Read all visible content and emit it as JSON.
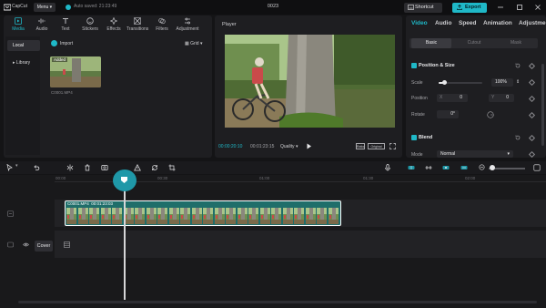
{
  "app": {
    "name": "CapCut",
    "menu_label": "Menu",
    "autosave_text": "Auto saved: 21:23:49",
    "project_title": "0023",
    "shortcut_label": "Shortcut",
    "export_label": "Export"
  },
  "media_panel": {
    "tabs": [
      {
        "label": "Media",
        "icon": "media-icon",
        "active": true
      },
      {
        "label": "Audio",
        "icon": "audio-icon",
        "active": false
      },
      {
        "label": "Text",
        "icon": "text-icon",
        "active": false
      },
      {
        "label": "Stickers",
        "icon": "stickers-icon",
        "active": false
      },
      {
        "label": "Effects",
        "icon": "effects-icon",
        "active": false
      },
      {
        "label": "Transitions",
        "icon": "transitions-icon",
        "active": false
      },
      {
        "label": "Filters",
        "icon": "filters-icon",
        "active": false
      },
      {
        "label": "Adjustment",
        "icon": "adjustment-icon",
        "active": false
      }
    ],
    "nav": [
      {
        "label": "Local",
        "active": true
      },
      {
        "label": "▸ Library",
        "active": false
      }
    ],
    "import_label": "Import",
    "view_label": "Grid",
    "item": {
      "badge": "Added",
      "filename": "C0001.MP4"
    }
  },
  "player": {
    "title": "Player",
    "current_time": "00:00:20:10",
    "total_time": "00:01:23:15",
    "quality_label": "Quality",
    "ratio_label": "Ratio",
    "original_label": "Original"
  },
  "properties": {
    "tabs": [
      {
        "label": "Video",
        "active": true
      },
      {
        "label": "Audio",
        "active": false
      },
      {
        "label": "Speed",
        "active": false
      },
      {
        "label": "Animation",
        "active": false
      },
      {
        "label": "Adjustme",
        "active": false
      }
    ],
    "sub_tabs": [
      {
        "label": "Basic",
        "active": true
      },
      {
        "label": "Cutout",
        "active": false
      },
      {
        "label": "Mask",
        "active": false
      }
    ],
    "position_size": {
      "title": "Position & Size",
      "scale_label": "Scale",
      "scale_value": "100%",
      "scale_level": 0.1,
      "position_label": "Position",
      "x_label": "X",
      "x_value": "0",
      "y_label": "Y",
      "y_value": "0",
      "rotate_label": "Rotate",
      "rotate_value": "0°"
    },
    "blend": {
      "title": "Blend",
      "mode_label": "Mode",
      "mode_value": "Normal"
    }
  },
  "timeline": {
    "ruler": [
      "00:00",
      "00:30",
      "01:00",
      "01:30",
      "02:00"
    ],
    "clip": {
      "name": "C0001.MP4",
      "duration": "00:01:23:03"
    },
    "cover_label": "Cover"
  },
  "colors": {
    "accent": "#1fb8c7",
    "background": "#141416",
    "panel": "#1e1e21",
    "clip": "#1f6e6a"
  }
}
